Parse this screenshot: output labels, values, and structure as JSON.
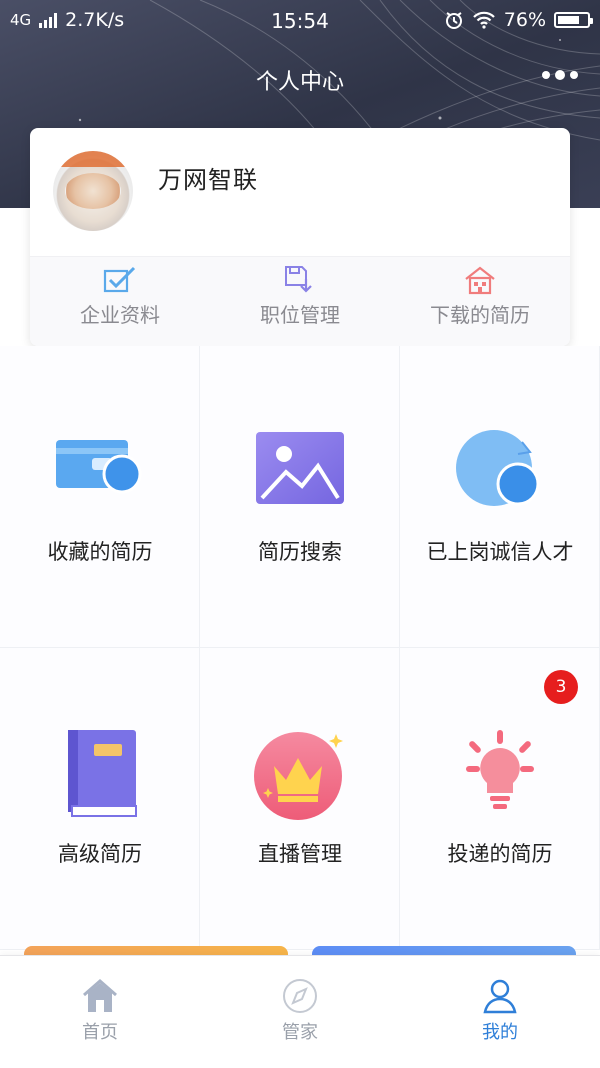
{
  "status_bar": {
    "network": "4G",
    "speed": "2.7K/s",
    "time": "15:54",
    "battery": "76%",
    "battery_level": 0.76
  },
  "header": {
    "title": "个人中心",
    "more_icon": "more-dots-icon"
  },
  "profile": {
    "company_name": "万网智联",
    "avatar": "avatar-image",
    "actions": [
      {
        "label": "企业资料",
        "icon": "checkbox-icon",
        "color": "#5aa9ea"
      },
      {
        "label": "职位管理",
        "icon": "save-download-icon",
        "color": "#8a82e6"
      },
      {
        "label": "下载的简历",
        "icon": "house-icon",
        "color": "#f07c7c"
      }
    ]
  },
  "features": [
    {
      "label": "收藏的简历",
      "icon": "card-wallet-icon"
    },
    {
      "label": "简历搜索",
      "icon": "image-mountain-icon"
    },
    {
      "label": "已上岗诚信人才",
      "icon": "circle-refresh-icon"
    },
    {
      "label": "高级简历",
      "icon": "book-icon"
    },
    {
      "label": "直播管理",
      "icon": "crown-icon"
    },
    {
      "label": "投递的简历",
      "icon": "lightbulb-icon",
      "badge": "3"
    }
  ],
  "tabbar": {
    "items": [
      {
        "label": "首页",
        "icon": "home-icon",
        "active": false
      },
      {
        "label": "管家",
        "icon": "compass-icon",
        "active": false
      },
      {
        "label": "我的",
        "icon": "user-icon",
        "active": true
      }
    ]
  },
  "colors": {
    "header_bg": "#383d52",
    "accent": "#2f7fd8",
    "badge": "#e61e1e"
  }
}
